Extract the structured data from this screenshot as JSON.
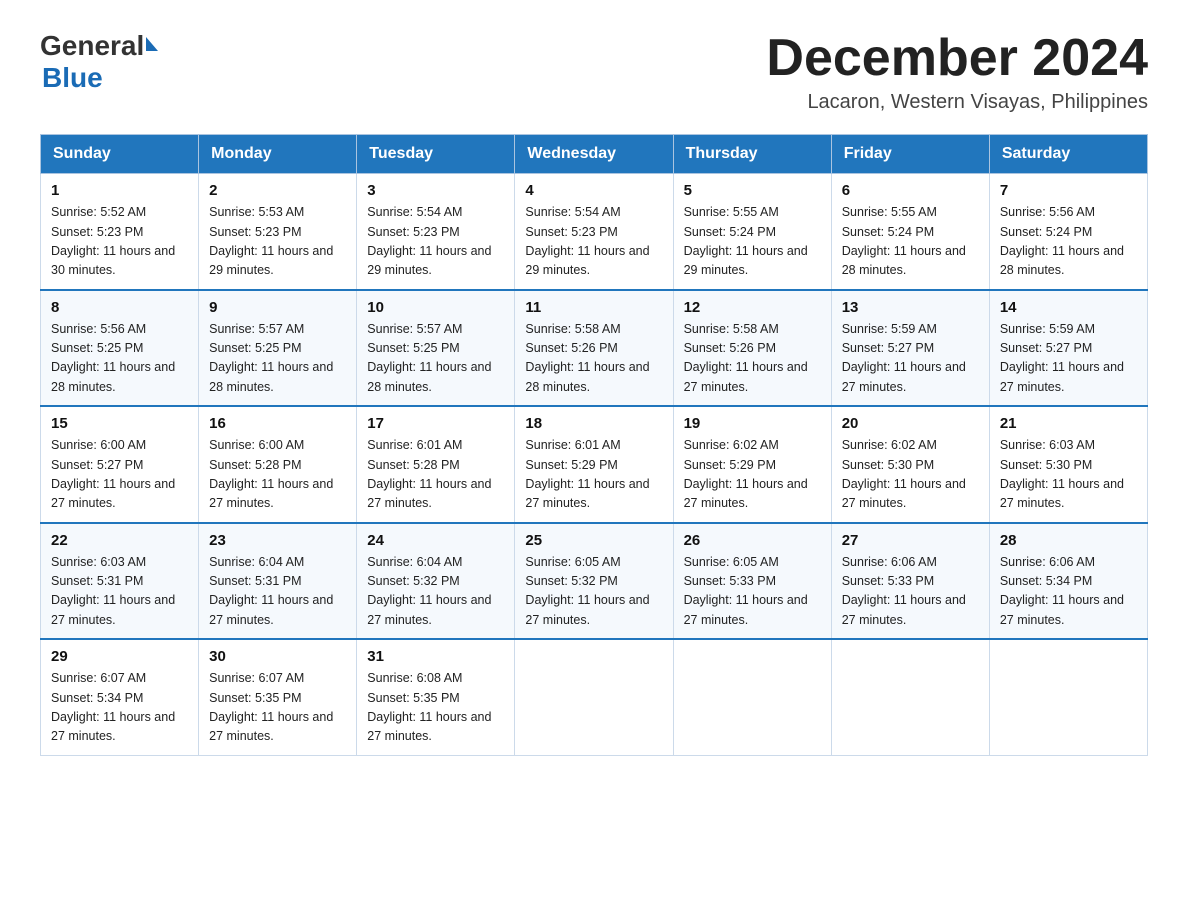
{
  "header": {
    "logo_general": "General",
    "logo_blue": "Blue",
    "month_title": "December 2024",
    "subtitle": "Lacaron, Western Visayas, Philippines"
  },
  "calendar": {
    "days_of_week": [
      "Sunday",
      "Monday",
      "Tuesday",
      "Wednesday",
      "Thursday",
      "Friday",
      "Saturday"
    ],
    "weeks": [
      [
        {
          "date": "1",
          "sunrise": "5:52 AM",
          "sunset": "5:23 PM",
          "daylight": "11 hours and 30 minutes."
        },
        {
          "date": "2",
          "sunrise": "5:53 AM",
          "sunset": "5:23 PM",
          "daylight": "11 hours and 29 minutes."
        },
        {
          "date": "3",
          "sunrise": "5:54 AM",
          "sunset": "5:23 PM",
          "daylight": "11 hours and 29 minutes."
        },
        {
          "date": "4",
          "sunrise": "5:54 AM",
          "sunset": "5:23 PM",
          "daylight": "11 hours and 29 minutes."
        },
        {
          "date": "5",
          "sunrise": "5:55 AM",
          "sunset": "5:24 PM",
          "daylight": "11 hours and 29 minutes."
        },
        {
          "date": "6",
          "sunrise": "5:55 AM",
          "sunset": "5:24 PM",
          "daylight": "11 hours and 28 minutes."
        },
        {
          "date": "7",
          "sunrise": "5:56 AM",
          "sunset": "5:24 PM",
          "daylight": "11 hours and 28 minutes."
        }
      ],
      [
        {
          "date": "8",
          "sunrise": "5:56 AM",
          "sunset": "5:25 PM",
          "daylight": "11 hours and 28 minutes."
        },
        {
          "date": "9",
          "sunrise": "5:57 AM",
          "sunset": "5:25 PM",
          "daylight": "11 hours and 28 minutes."
        },
        {
          "date": "10",
          "sunrise": "5:57 AM",
          "sunset": "5:25 PM",
          "daylight": "11 hours and 28 minutes."
        },
        {
          "date": "11",
          "sunrise": "5:58 AM",
          "sunset": "5:26 PM",
          "daylight": "11 hours and 28 minutes."
        },
        {
          "date": "12",
          "sunrise": "5:58 AM",
          "sunset": "5:26 PM",
          "daylight": "11 hours and 27 minutes."
        },
        {
          "date": "13",
          "sunrise": "5:59 AM",
          "sunset": "5:27 PM",
          "daylight": "11 hours and 27 minutes."
        },
        {
          "date": "14",
          "sunrise": "5:59 AM",
          "sunset": "5:27 PM",
          "daylight": "11 hours and 27 minutes."
        }
      ],
      [
        {
          "date": "15",
          "sunrise": "6:00 AM",
          "sunset": "5:27 PM",
          "daylight": "11 hours and 27 minutes."
        },
        {
          "date": "16",
          "sunrise": "6:00 AM",
          "sunset": "5:28 PM",
          "daylight": "11 hours and 27 minutes."
        },
        {
          "date": "17",
          "sunrise": "6:01 AM",
          "sunset": "5:28 PM",
          "daylight": "11 hours and 27 minutes."
        },
        {
          "date": "18",
          "sunrise": "6:01 AM",
          "sunset": "5:29 PM",
          "daylight": "11 hours and 27 minutes."
        },
        {
          "date": "19",
          "sunrise": "6:02 AM",
          "sunset": "5:29 PM",
          "daylight": "11 hours and 27 minutes."
        },
        {
          "date": "20",
          "sunrise": "6:02 AM",
          "sunset": "5:30 PM",
          "daylight": "11 hours and 27 minutes."
        },
        {
          "date": "21",
          "sunrise": "6:03 AM",
          "sunset": "5:30 PM",
          "daylight": "11 hours and 27 minutes."
        }
      ],
      [
        {
          "date": "22",
          "sunrise": "6:03 AM",
          "sunset": "5:31 PM",
          "daylight": "11 hours and 27 minutes."
        },
        {
          "date": "23",
          "sunrise": "6:04 AM",
          "sunset": "5:31 PM",
          "daylight": "11 hours and 27 minutes."
        },
        {
          "date": "24",
          "sunrise": "6:04 AM",
          "sunset": "5:32 PM",
          "daylight": "11 hours and 27 minutes."
        },
        {
          "date": "25",
          "sunrise": "6:05 AM",
          "sunset": "5:32 PM",
          "daylight": "11 hours and 27 minutes."
        },
        {
          "date": "26",
          "sunrise": "6:05 AM",
          "sunset": "5:33 PM",
          "daylight": "11 hours and 27 minutes."
        },
        {
          "date": "27",
          "sunrise": "6:06 AM",
          "sunset": "5:33 PM",
          "daylight": "11 hours and 27 minutes."
        },
        {
          "date": "28",
          "sunrise": "6:06 AM",
          "sunset": "5:34 PM",
          "daylight": "11 hours and 27 minutes."
        }
      ],
      [
        {
          "date": "29",
          "sunrise": "6:07 AM",
          "sunset": "5:34 PM",
          "daylight": "11 hours and 27 minutes."
        },
        {
          "date": "30",
          "sunrise": "6:07 AM",
          "sunset": "5:35 PM",
          "daylight": "11 hours and 27 minutes."
        },
        {
          "date": "31",
          "sunrise": "6:08 AM",
          "sunset": "5:35 PM",
          "daylight": "11 hours and 27 minutes."
        },
        null,
        null,
        null,
        null
      ]
    ]
  }
}
